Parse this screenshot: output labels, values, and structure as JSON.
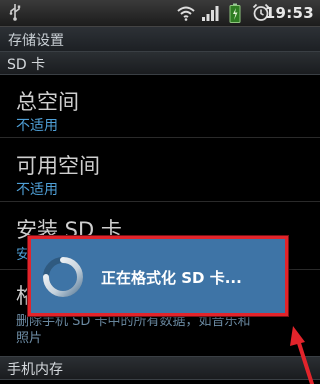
{
  "status_bar": {
    "time": "19:53",
    "icons": [
      "usb-icon",
      "wifi-icon",
      "signal-icon",
      "battery-icon",
      "alarm-icon"
    ]
  },
  "page_title": "存储设置",
  "sd_section": {
    "header": "SD 卡",
    "items": [
      {
        "title": "总空间",
        "subtitle": "不适用"
      },
      {
        "title": "可用空间",
        "subtitle": "不适用"
      },
      {
        "title": "安装 SD 卡",
        "subtitle": "安"
      },
      {
        "title": "格",
        "desc_line1": "删除手机 SD 卡中的所有数据，如音乐和",
        "desc_line2": "照片"
      }
    ]
  },
  "phone_section": {
    "header": "手机内存"
  },
  "dialog": {
    "message": "正在格式化 SD 卡..."
  },
  "colors": {
    "dialog_bg": "#3e74a6",
    "dialog_border": "#e2242b",
    "subtitle": "#4f9fd6",
    "annotation_arrow": "#e2242b"
  }
}
